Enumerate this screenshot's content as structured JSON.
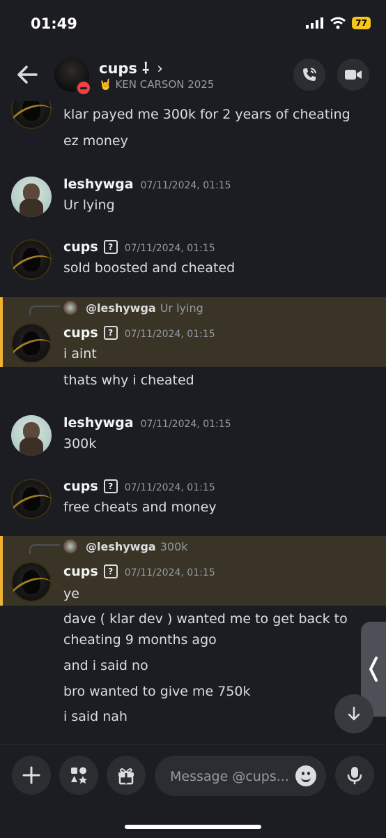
{
  "status_bar": {
    "time": "01:49",
    "battery": "77"
  },
  "header": {
    "name": "cups ⸸",
    "chevron": "›",
    "status_emoji": "🤘",
    "status_text": "KEN CARSON 2025"
  },
  "messages": [
    {
      "id": "m0",
      "lines": [
        "klar payed me 300k for 2 years of cheating",
        "ez money"
      ]
    },
    {
      "id": "m1",
      "user": "leshywga",
      "time": "07/11/2024, 01:15",
      "lines": [
        "Ur lying"
      ]
    },
    {
      "id": "m2",
      "user": "cups",
      "tag": "?",
      "time": "07/11/2024, 01:15",
      "lines": [
        "sold boosted and cheated"
      ]
    },
    {
      "id": "m3",
      "reply_to": "@leshywga",
      "reply_text": "Ur lying",
      "user": "cups",
      "tag": "?",
      "time": "07/11/2024, 01:15",
      "lines": [
        "i aint",
        "thats why i cheated"
      ]
    },
    {
      "id": "m4",
      "user": "leshywga",
      "time": "07/11/2024, 01:15",
      "lines": [
        "300k"
      ]
    },
    {
      "id": "m5",
      "user": "cups",
      "tag": "?",
      "time": "07/11/2024, 01:15",
      "lines": [
        "free cheats and money"
      ]
    },
    {
      "id": "m6",
      "reply_to": "@leshywga",
      "reply_text": "300k",
      "user": "cups",
      "tag": "?",
      "time": "07/11/2024, 01:15",
      "lines": [
        "ye",
        "dave ( klar dev ) wanted me to get back to",
        "cheating 9 months ago",
        "and i said no",
        "bro wanted to give me 750k",
        "i said nah"
      ]
    }
  ],
  "composer": {
    "placeholder": "Message @cups..."
  },
  "icons": {
    "back": "arrow-left-icon",
    "call": "phone-call-icon",
    "video": "video-camera-icon",
    "add": "plus-icon",
    "apps": "apps-icon",
    "gift": "gift-icon",
    "emoji": "emoji-icon",
    "mic": "microphone-icon",
    "jump": "arrow-down-icon",
    "drawer": "chevron-left-icon"
  },
  "colors": {
    "background": "#1c1d22",
    "highlight": "#3a3426",
    "highlight_bar": "#f0b232",
    "dnd": "#f23f43",
    "battery": "#f5c518"
  }
}
